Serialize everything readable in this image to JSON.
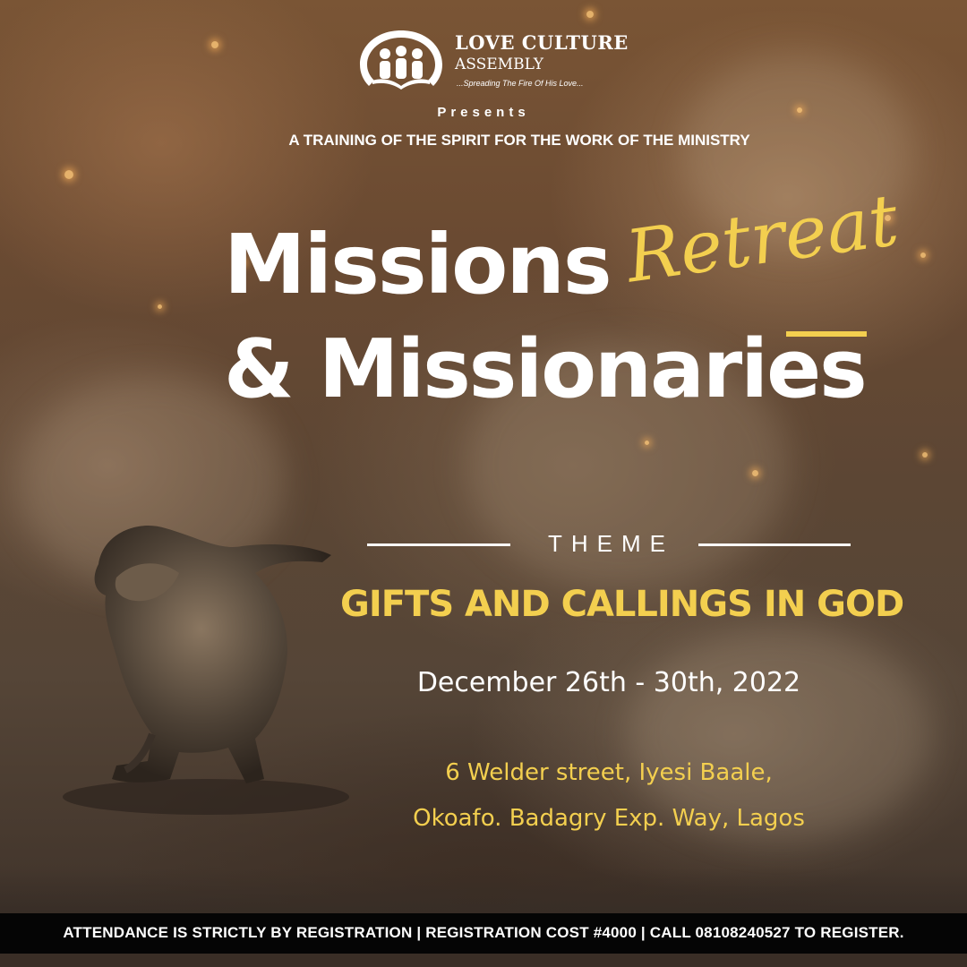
{
  "logo": {
    "title": "LOVE CULTURE",
    "subtitle": "ASSEMBLY",
    "tagline": "...Spreading The Fire Of His Love...",
    "icon": "three-people-book-icon"
  },
  "presents": "Presents",
  "training": "A TRAINING OF THE SPIRIT FOR THE WORK OF THE MINISTRY",
  "title": {
    "line1": "Missions",
    "line2": "& Missionaries",
    "script": "Retreat"
  },
  "theme": {
    "label": "THEME",
    "text": "GIFTS AND CALLINGS IN GOD"
  },
  "date": "December 26th - 30th, 2022",
  "address": {
    "line1": "6 Welder street, Iyesi Baale,",
    "line2": "Okoafo. Badagry Exp. Way, Lagos"
  },
  "footer": "ATTENDANCE IS STRICTLY BY REGISTRATION | REGISTRATION COST #4000 | CALL 08108240527 TO REGISTER.",
  "colors": {
    "accent": "#f3cf4f",
    "text": "#ffffff",
    "footer_bg": "#050505"
  }
}
